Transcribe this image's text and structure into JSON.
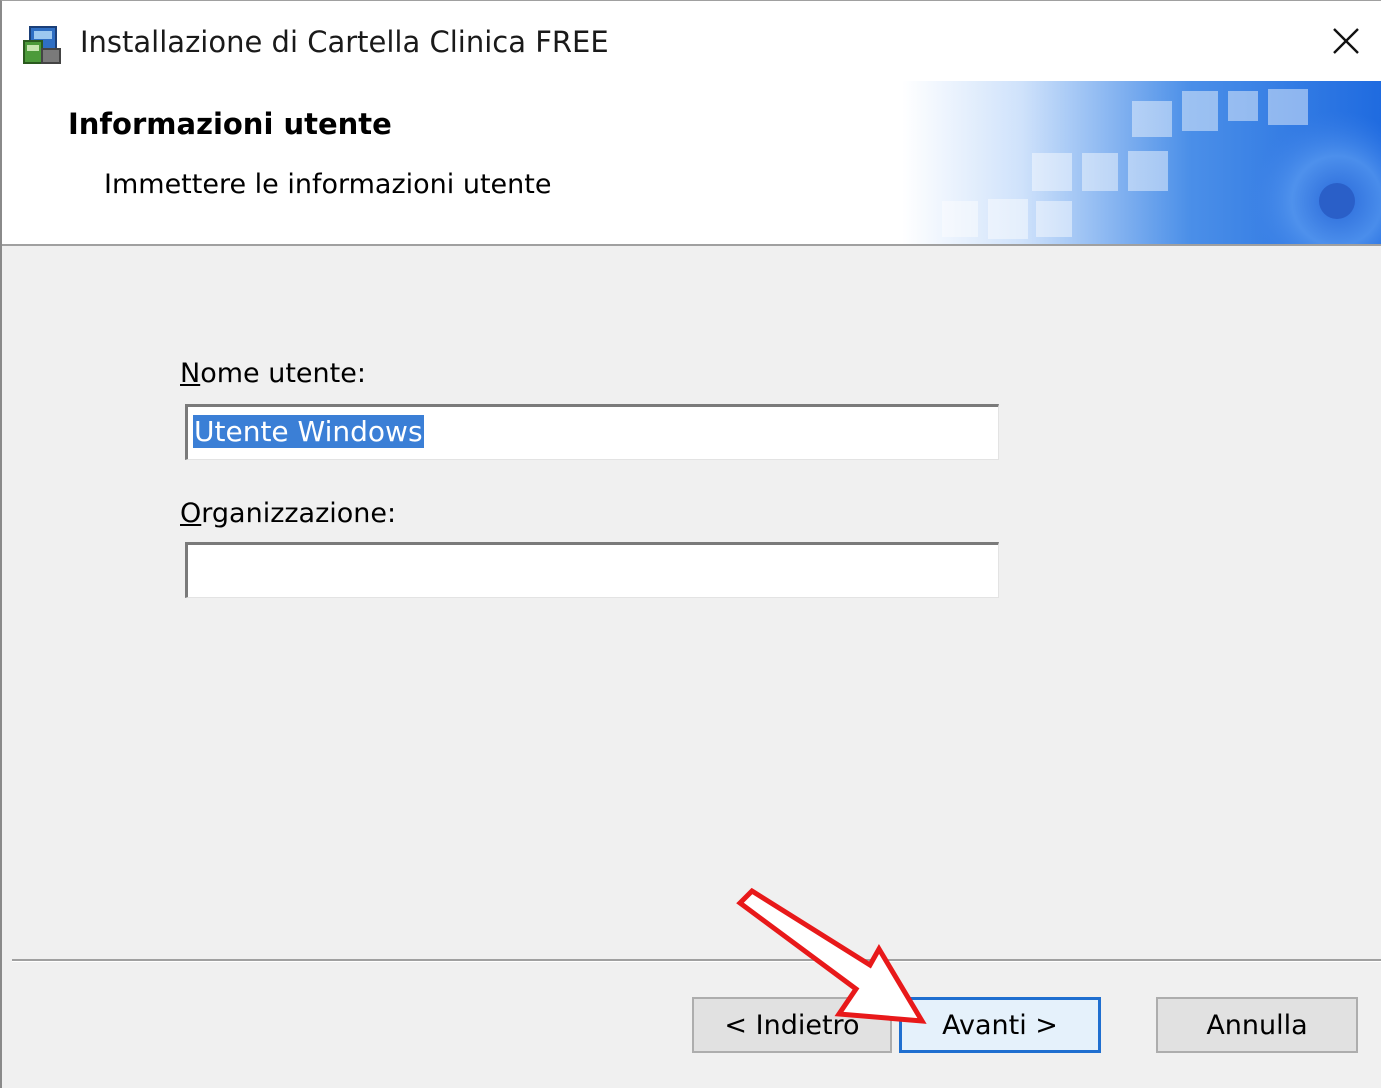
{
  "window": {
    "title": "Installazione di Cartella Clinica FREE",
    "close_glyph": "✕"
  },
  "header": {
    "title": "Informazioni utente",
    "subtitle": "Immettere le informazioni utente"
  },
  "form": {
    "username": {
      "label_accel": "N",
      "label_rest": "ome utente:",
      "value": "Utente Windows"
    },
    "organization": {
      "label_accel": "O",
      "label_rest": "rganizzazione:",
      "value": ""
    }
  },
  "buttons": {
    "back": "< Indietro",
    "next": "Avanti >",
    "cancel": "Annulla"
  },
  "colors": {
    "selection": "#3b7fd6",
    "focus_border": "#1f6fd0",
    "annotation_arrow": "#e8191a"
  },
  "icons": {
    "app": "installer-package-icon",
    "close": "close-icon",
    "banner": "header-banner-graphic",
    "annotation": "red-arrow-annotation"
  }
}
